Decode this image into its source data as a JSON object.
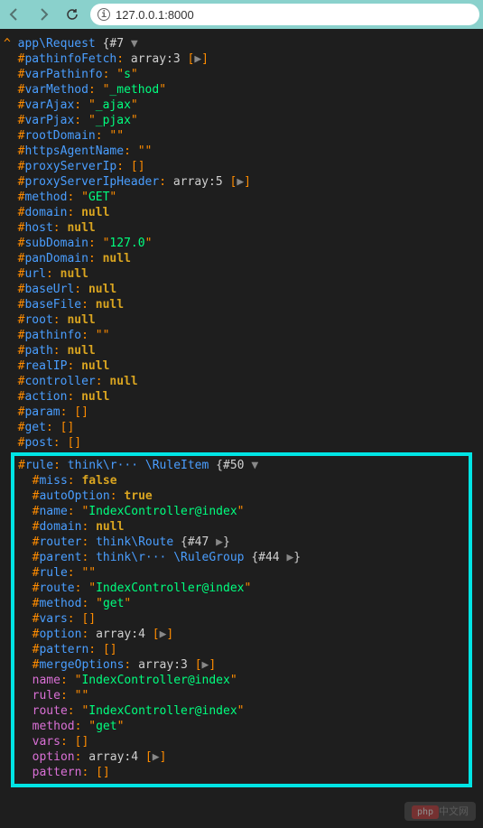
{
  "browser": {
    "url": "127.0.0.1:8000"
  },
  "dump": {
    "caret": "^",
    "class": "app\\Request",
    "id": "#7",
    "arrow": "▼",
    "play": "▶",
    "props": [
      {
        "name": "pathinfoFetch",
        "type": "array",
        "count": "3",
        "expandable": true
      },
      {
        "name": "varPathinfo",
        "value": "s",
        "isString": true
      },
      {
        "name": "varMethod",
        "value": "_method",
        "isString": true
      },
      {
        "name": "varAjax",
        "value": "_ajax",
        "isString": true
      },
      {
        "name": "varPjax",
        "value": "_pjax",
        "isString": true
      },
      {
        "name": "rootDomain",
        "value": "",
        "isString": true
      },
      {
        "name": "httpsAgentName",
        "value": "",
        "isString": true
      },
      {
        "name": "proxyServerIp",
        "isArray": true
      },
      {
        "name": "proxyServerIpHeader",
        "type": "array",
        "count": "5",
        "expandable": true
      },
      {
        "name": "method",
        "value": "GET",
        "isString": true
      },
      {
        "name": "domain",
        "isNull": true
      },
      {
        "name": "host",
        "isNull": true
      },
      {
        "name": "subDomain",
        "value": "127.0",
        "isString": true
      },
      {
        "name": "panDomain",
        "isNull": true
      },
      {
        "name": "url",
        "isNull": true
      },
      {
        "name": "baseUrl",
        "isNull": true
      },
      {
        "name": "baseFile",
        "isNull": true
      },
      {
        "name": "root",
        "isNull": true
      },
      {
        "name": "pathinfo",
        "value": "",
        "isString": true
      },
      {
        "name": "path",
        "isNull": true
      },
      {
        "name": "realIP",
        "isNull": true
      },
      {
        "name": "controller",
        "isNull": true
      },
      {
        "name": "action",
        "isNull": true
      },
      {
        "name": "param",
        "isArray": true
      },
      {
        "name": "get",
        "isArray": true
      },
      {
        "name": "post",
        "isArray": true
      }
    ],
    "highlighted": {
      "ruleHeader": {
        "name": "rule",
        "namespace": "think\\r··· \\RuleItem",
        "id": "#50",
        "arrow": "▼"
      },
      "protectedProps": [
        {
          "name": "miss",
          "isBool": true,
          "value": "false"
        },
        {
          "name": "autoOption",
          "isBool": true,
          "value": "true"
        },
        {
          "name": "name",
          "value": "IndexController@index",
          "isString": true
        },
        {
          "name": "domain",
          "isNull": true
        },
        {
          "name": "router",
          "namespace": "think\\Route",
          "id": "#47",
          "isObject": true
        },
        {
          "name": "parent",
          "namespace": "think\\r··· \\RuleGroup",
          "id": "#44",
          "isObject": true
        },
        {
          "name": "rule",
          "value": "",
          "isString": true
        },
        {
          "name": "route",
          "value": "IndexController@index",
          "isString": true
        },
        {
          "name": "method",
          "value": "get",
          "isString": true
        },
        {
          "name": "vars",
          "isArray": true
        },
        {
          "name": "option",
          "type": "array",
          "count": "4",
          "expandable": true
        },
        {
          "name": "pattern",
          "isArray": true
        },
        {
          "name": "mergeOptions",
          "type": "array",
          "count": "3",
          "expandable": true
        }
      ],
      "publicProps": [
        {
          "name": "name",
          "value": "IndexController@index",
          "isString": true
        },
        {
          "name": "rule",
          "value": "",
          "isString": true
        },
        {
          "name": "route",
          "value": "IndexController@index",
          "isString": true
        },
        {
          "name": "method",
          "value": "get",
          "isString": true
        },
        {
          "name": "vars",
          "isArray": true
        },
        {
          "name": "option",
          "type": "array",
          "count": "4",
          "expandable": true
        },
        {
          "name": "pattern",
          "isArray": true
        }
      ]
    }
  },
  "watermark": {
    "logo": "php",
    "text": "中文网"
  }
}
